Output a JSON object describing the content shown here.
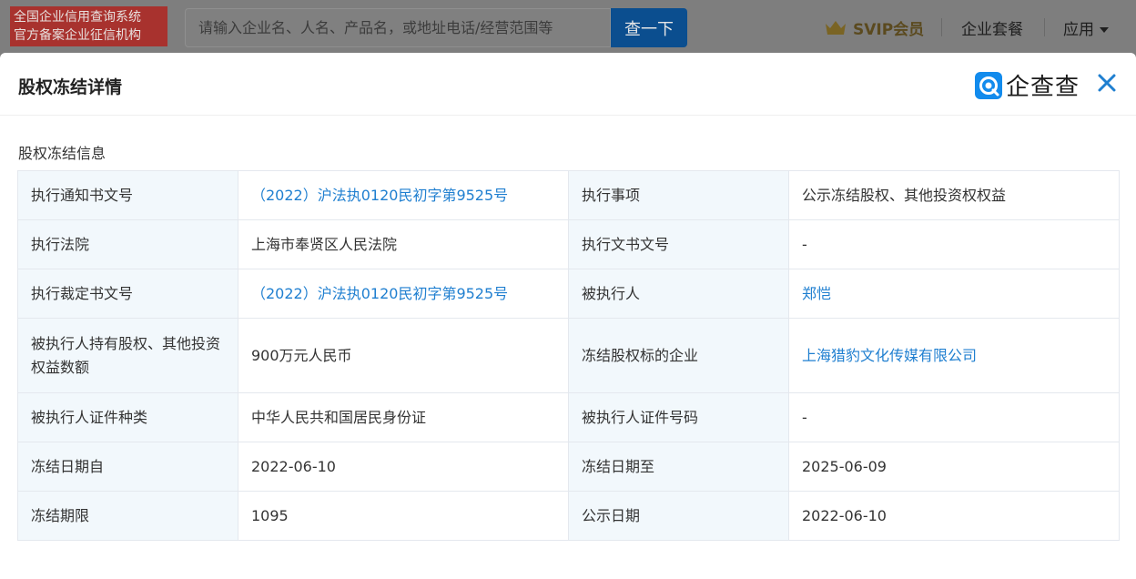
{
  "topbar": {
    "brand_line1": "全国企业信用查询系统",
    "brand_line2": "官方备案企业征信机构",
    "search_placeholder": "请输入企业名、人名、产品名，或地址电话/经营范围等",
    "search_button": "查一下",
    "svip_label": "SVIP会员",
    "nav_package": "企业套餐",
    "nav_apps": "应用"
  },
  "modal": {
    "title": "股权冻结详情",
    "logo_text": "企查查",
    "section_title": "股权冻结信息",
    "rows": [
      {
        "l1": "执行通知书文号",
        "v1": "（2022）沪法执0120民初字第9525号",
        "l2": "执行事项",
        "v2": "公示冻结股权、其他投资权权益"
      },
      {
        "l1": "执行法院",
        "v1": "上海市奉贤区人民法院",
        "l2": "执行文书文号",
        "v2": "-"
      },
      {
        "l1": "执行裁定书文号",
        "v1": "（2022）沪法执0120民初字第9525号",
        "l2": "被执行人",
        "v2": "郑恺"
      },
      {
        "l1": "被执行人持有股权、其他投资权益数额",
        "v1": "900万元人民币",
        "l2": "冻结股权标的企业",
        "v2": "上海猎豹文化传媒有限公司"
      },
      {
        "l1": "被执行人证件种类",
        "v1": "中华人民共和国居民身份证",
        "l2": "被执行人证件号码",
        "v2": "-"
      },
      {
        "l1": "冻结日期自",
        "v1": "2022-06-10",
        "l2": "冻结日期至",
        "v2": "2025-06-09"
      },
      {
        "l1": "冻结期限",
        "v1": "1095",
        "l2": "公示日期",
        "v2": "2022-06-10"
      }
    ]
  },
  "colors": {
    "link": "#1f7fd0",
    "label_bg": "#f2f8fc",
    "brand_red": "#a8322e",
    "search_btn": "#0b4e8f",
    "close_icon": "#1f7fd0"
  }
}
